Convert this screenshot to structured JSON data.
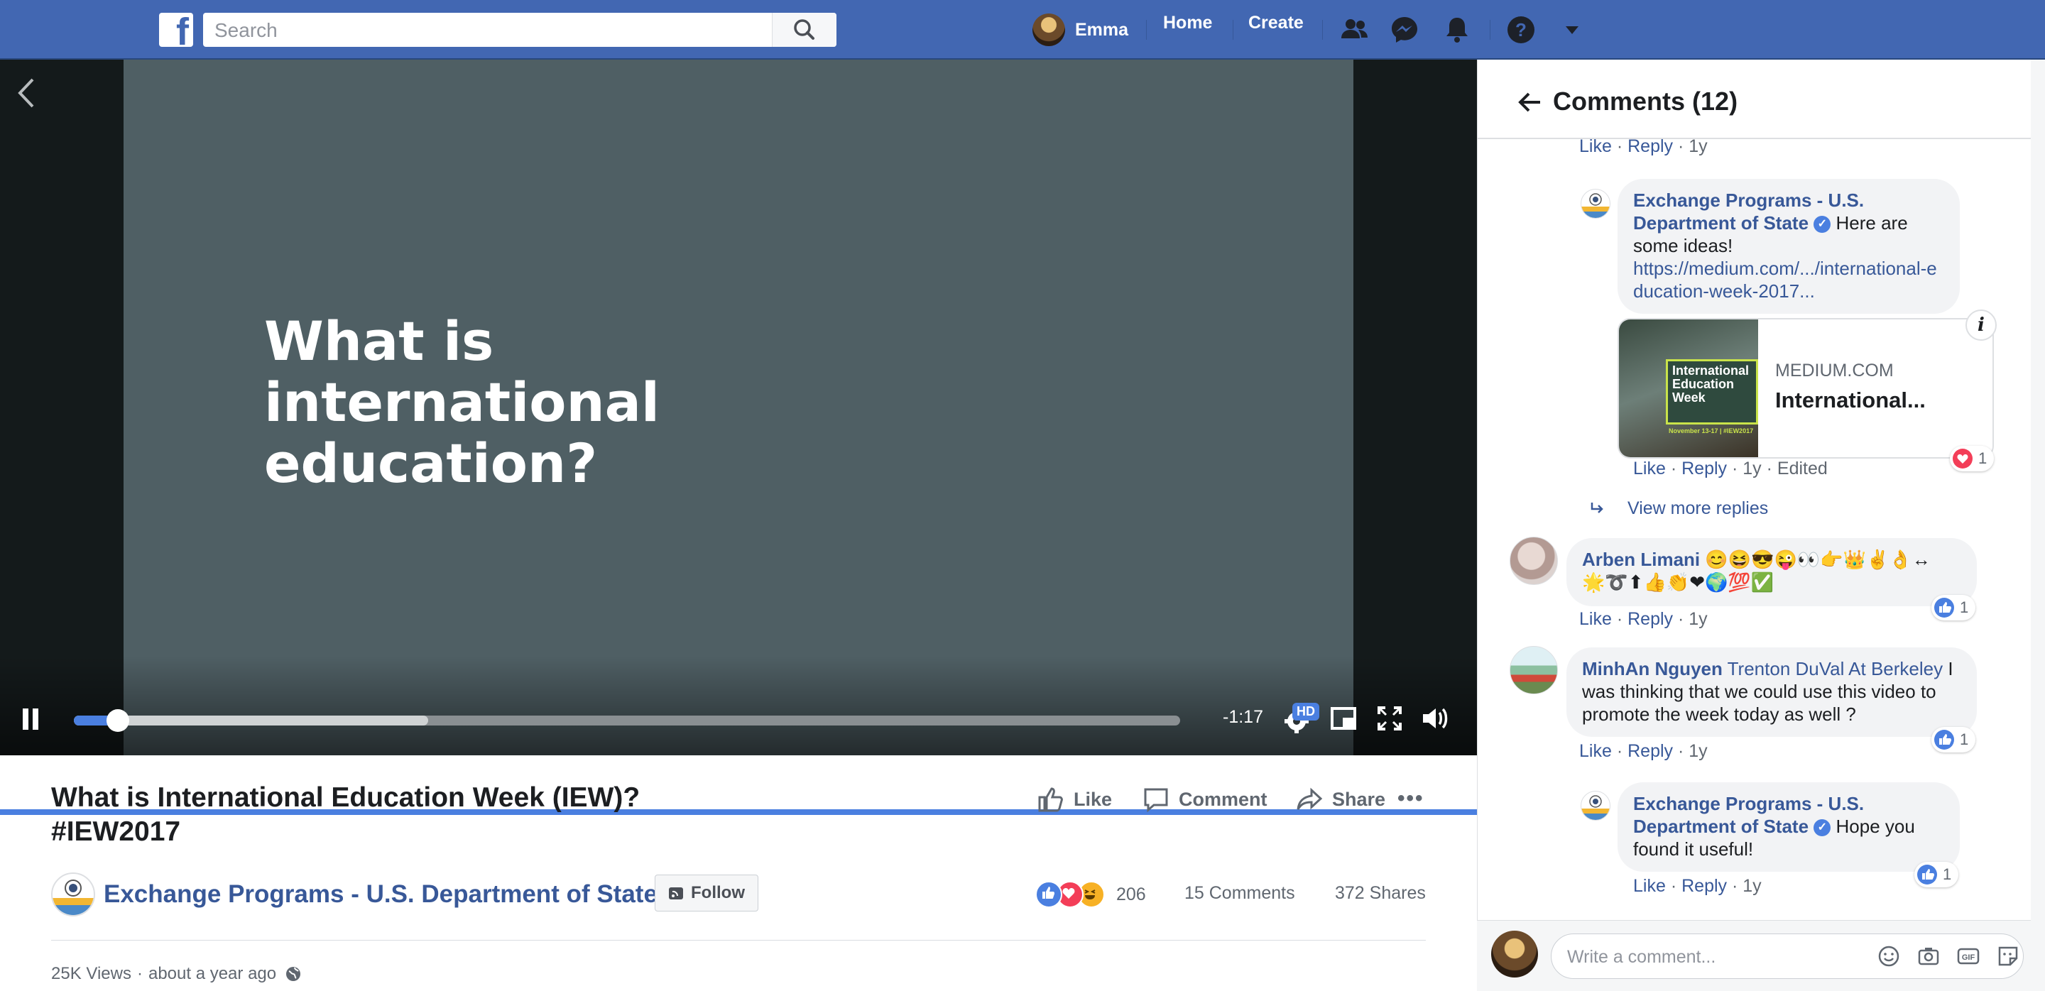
{
  "topbar": {
    "search_placeholder": "Search",
    "user_name": "Emma",
    "home_label": "Home",
    "create_label": "Create"
  },
  "video": {
    "slide_text": "What is international education?",
    "time_remaining": "-1:17",
    "hd_label": "HD",
    "progress_played": 0.04,
    "progress_buffered": 0.32
  },
  "post": {
    "title": "What is International Education Week (IEW)? #IEW2017",
    "like_label": "Like",
    "comment_label": "Comment",
    "share_label": "Share",
    "page_name": "Exchange Programs - U.S. Department of State",
    "follow_label": "Follow",
    "reaction_count": "206",
    "comments_count": "15 Comments",
    "shares_count": "372 Shares",
    "views": "25K Views",
    "posted": "about a year ago",
    "meta_sep": "·"
  },
  "comments": {
    "title": "Comments (12)",
    "like": "Like",
    "reply": "Reply",
    "dot": "·",
    "top_time": "1y",
    "reply1": {
      "author": "Exchange Programs - U.S. Department of State",
      "text": "Here are some ideas!",
      "link": "https://medium.com/.../international-education-week-2017...",
      "card_domain": "MEDIUM.COM",
      "card_title": "International...",
      "card_image_text": "International Education Week",
      "card_image_caption": "November 13-17 | #IEW2017",
      "time": "1y",
      "edited": "Edited",
      "reaction_count": "1"
    },
    "view_more": "View more replies",
    "c2": {
      "author": "Arben Limani",
      "emojis_line1": "😊😆😎😜👀👉👑✌👌↔",
      "emojis_line2": "🌟➰⬆👍👏❤🌍💯✅",
      "time": "1y",
      "reaction_count": "1"
    },
    "c3": {
      "author": "MinhAn Nguyen",
      "mention": "Trenton DuVal At Berkeley",
      "text": "I was thinking that we could use this video to promote the week today as well ?",
      "time": "1y",
      "reaction_count": "1"
    },
    "reply2": {
      "author": "Exchange Programs - U.S. Department of State",
      "text": "Hope you found it useful!",
      "time": "1y",
      "reaction_count": "1"
    },
    "write_placeholder": "Write a comment..."
  },
  "colors": {
    "brand": "#4267b2",
    "link": "#385898",
    "like_blue": "#4a7fe0",
    "love_red": "#f33e58"
  }
}
